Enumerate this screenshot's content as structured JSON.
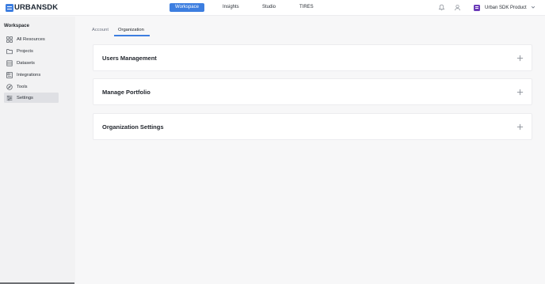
{
  "app": {
    "logo_urban": "URBAN",
    "logo_sdk": "SDK",
    "brand_color": "#3d7ee0"
  },
  "nav": {
    "items": [
      {
        "label": "Workspace",
        "active": true
      },
      {
        "label": "Insights",
        "active": false
      },
      {
        "label": "Studio",
        "active": false
      },
      {
        "label": "TIRES",
        "active": false
      }
    ]
  },
  "topbar": {
    "icons": [
      "bell-icon",
      "user-icon"
    ],
    "product_name": "Urban SDK Product",
    "product_badge_color": "#6b3bb8"
  },
  "sidebar": {
    "heading": "Workspace",
    "items": [
      {
        "label": "All Resources",
        "icon": "grid-icon",
        "active": false
      },
      {
        "label": "Projects",
        "icon": "folder-icon",
        "active": false
      },
      {
        "label": "Datasets",
        "icon": "database-icon",
        "active": false
      },
      {
        "label": "Integrations",
        "icon": "plug-icon",
        "active": false
      },
      {
        "label": "Tools",
        "icon": "compass-icon",
        "active": false
      },
      {
        "label": "Settings",
        "icon": "sliders-icon",
        "active": true
      }
    ]
  },
  "tabs": [
    {
      "label": "Account",
      "active": false
    },
    {
      "label": "Organization",
      "active": true
    }
  ],
  "panels": [
    {
      "title": "Users Management",
      "expand_icon": "plus-icon"
    },
    {
      "title": "Manage Portfolio",
      "expand_icon": "plus-icon"
    },
    {
      "title": "Organization Settings",
      "expand_icon": "plus-icon"
    }
  ]
}
